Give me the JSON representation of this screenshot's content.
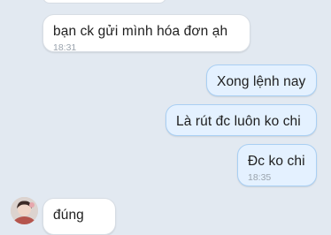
{
  "messages": [
    {
      "direction": "in",
      "text": "bạn ck  gửi  mình  hóa đơn ạh",
      "time": "18:31"
    },
    {
      "direction": "out",
      "text": "Xong lệnh nay"
    },
    {
      "direction": "out",
      "text": "Là rút đc luôn ko chi"
    },
    {
      "direction": "out",
      "text": "Đc ko chi",
      "time": "18:35"
    },
    {
      "direction": "in",
      "text": "đúng"
    }
  ],
  "colors": {
    "background": "#e2e9f1",
    "incoming_bubble": "#ffffff",
    "outgoing_bubble": "#e4f1ff",
    "outgoing_border": "#a9cff3",
    "time_text": "#9aa3ad"
  },
  "icons": {
    "contact_avatar": "avatar-photo"
  }
}
